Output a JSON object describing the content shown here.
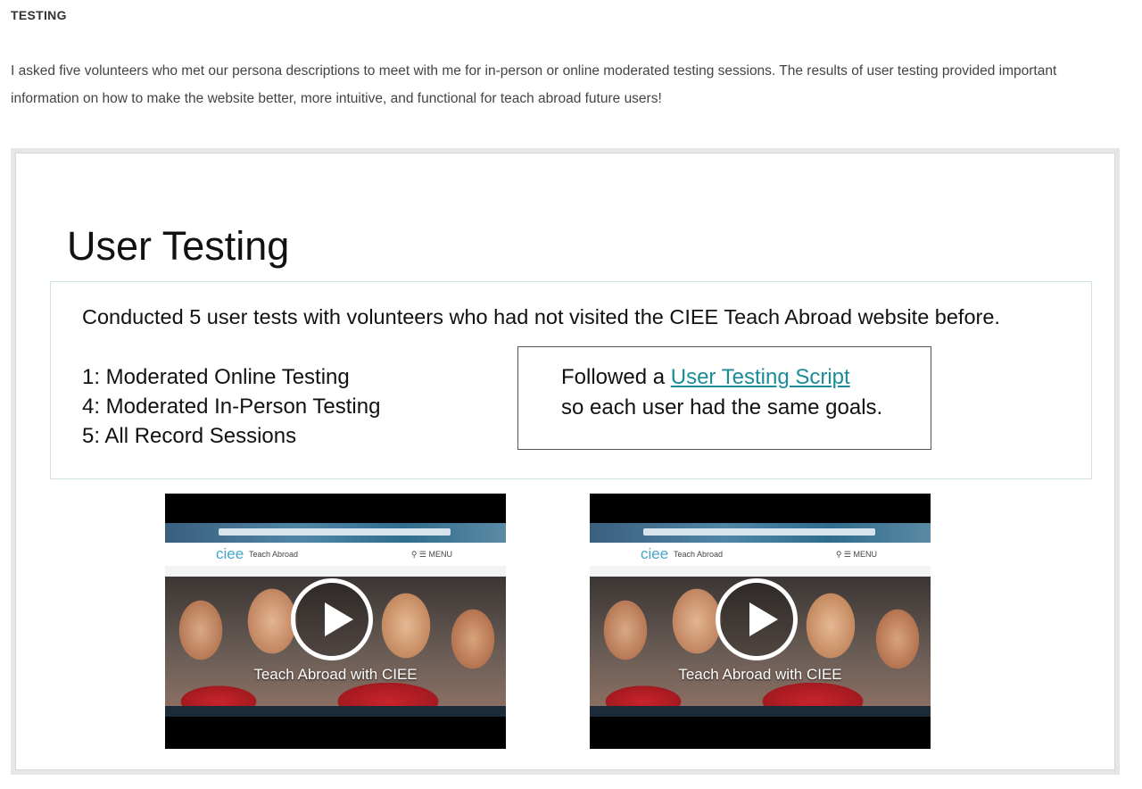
{
  "section": {
    "heading": "TESTING",
    "intro": "I asked five volunteers who met our persona descriptions to meet with me for in-person or online moderated testing sessions. The results of user testing provided important information on how to make the website better, more intuitive, and functional for teach abroad future users!"
  },
  "slide": {
    "title": "User Testing",
    "conducted": "Conducted 5 user tests with volunteers who had not visited the CIEE Teach Abroad website before.",
    "list": [
      "1: Moderated Online Testing",
      "4: Moderated In-Person Testing",
      "5: All Record Sessions"
    ],
    "script_box": {
      "prefix": "Followed a ",
      "link_text": "User Testing Script",
      "line2": "so each user had the same goals."
    }
  },
  "videos": [
    {
      "logo": "ciee",
      "site_name": "Teach Abroad",
      "header_icons": "⚲ ☰ MENU",
      "hero_text": "Teach Abroad with CIEE",
      "icon": "play-icon"
    },
    {
      "logo": "ciee",
      "site_name": "Teach Abroad",
      "header_icons": "⚲ ☰ MENU",
      "hero_text": "Teach Abroad with CIEE",
      "icon": "play-icon"
    }
  ],
  "colors": {
    "link": "#1b8c9a",
    "content_border": "#cfe3e6",
    "frame_bg": "#e6e6e6"
  }
}
